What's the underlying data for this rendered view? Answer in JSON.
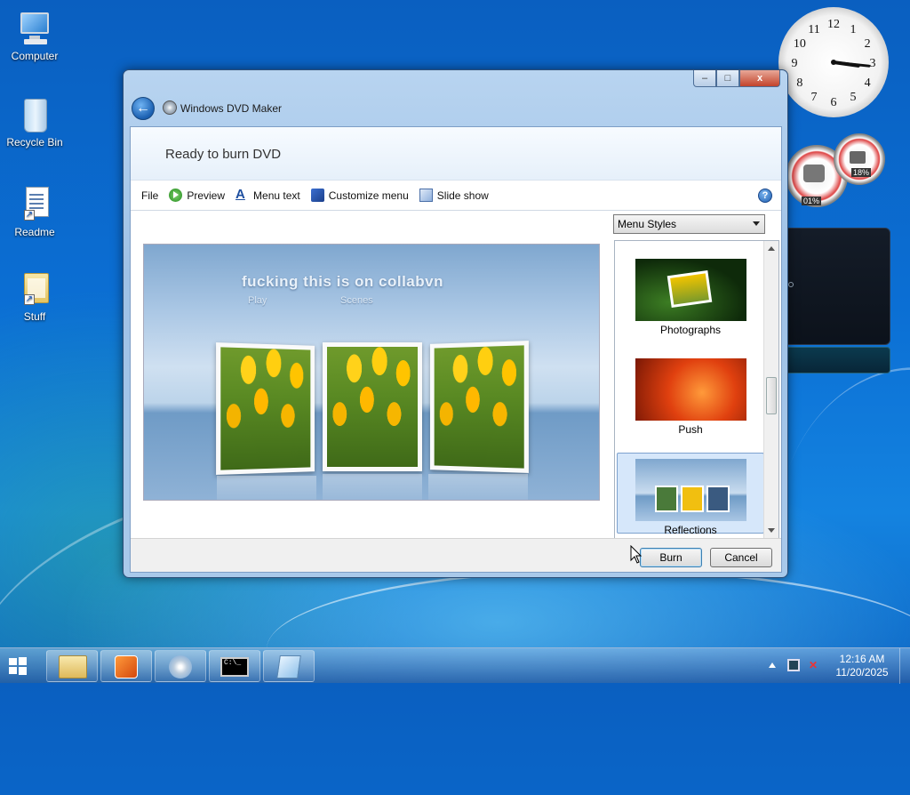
{
  "desktop": {
    "icons": [
      {
        "label": "Computer",
        "icon": "computer-icon"
      },
      {
        "label": "Recycle Bin",
        "icon": "recycle-bin-icon"
      },
      {
        "label": "Readme",
        "icon": "document-shortcut-icon"
      },
      {
        "label": "Stuff",
        "icon": "folder-shortcut-icon"
      }
    ]
  },
  "gadgets": {
    "clock": {
      "numerals": [
        "12",
        "1",
        "2",
        "3",
        "4",
        "5",
        "6",
        "7",
        "8",
        "9",
        "10",
        "11"
      ],
      "hour": 3,
      "minute": 16
    },
    "cpu_meter": {
      "value": "01%"
    },
    "ram_meter": {
      "value": "18%"
    }
  },
  "window": {
    "app_title": "Windows DVD Maker",
    "header": "Ready to burn DVD",
    "toolbar": {
      "file": "File",
      "preview": "Preview",
      "menu_text": "Menu text",
      "customize_menu": "Customize menu",
      "slide_show": "Slide show"
    },
    "help_glyph": "?",
    "preview": {
      "title": "fucking this is on collabvn",
      "play": "Play",
      "scenes": "Scenes"
    },
    "menu_styles": {
      "dropdown": "Menu Styles",
      "items": [
        {
          "label": "Photographs",
          "selected": false
        },
        {
          "label": "Push",
          "selected": false
        },
        {
          "label": "Reflections",
          "selected": true
        }
      ]
    },
    "buttons": {
      "burn": "Burn",
      "cancel": "Cancel"
    },
    "caption": {
      "minimize": "‒",
      "maximize": "□",
      "close": "x"
    }
  },
  "taskbar": {
    "time": "12:16 AM",
    "date": "11/20/2025",
    "apps": [
      "explorer",
      "media-player",
      "dvd-maker",
      "command-prompt",
      "notepad"
    ]
  },
  "colors": {
    "accent": "#1a5fb0",
    "selection": "#d6e7fa"
  }
}
